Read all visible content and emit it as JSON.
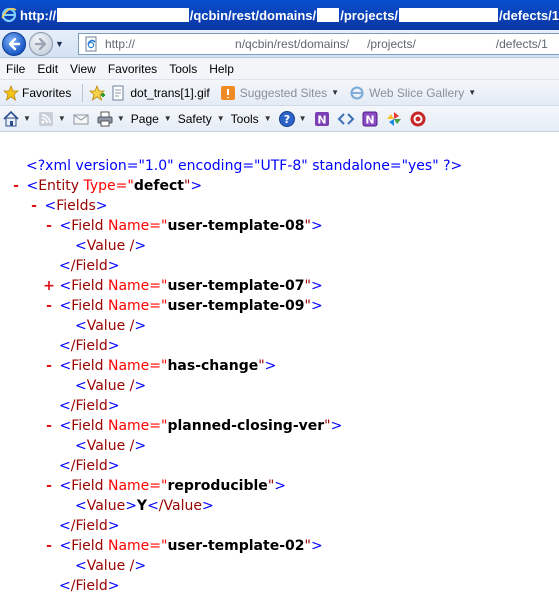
{
  "window": {
    "url_prefix": "http://",
    "url_part_1": "/qcbin/rest/domains/",
    "url_part_2": "/projects/",
    "url_part_3": "/defects/1"
  },
  "address_bar": {
    "url_prefix": "http://",
    "url_part_1": "n/qcbin/rest/domains/",
    "url_part_2": "/projects/",
    "url_part_3": "/defects/1"
  },
  "menu": [
    "File",
    "Edit",
    "View",
    "Favorites",
    "Tools",
    "Help"
  ],
  "favorites_bar": {
    "favorites_label": "Favorites",
    "items": [
      {
        "label": "dot_trans[1].gif",
        "icon": "page-icon",
        "enabled": true
      },
      {
        "label": "Suggested Sites",
        "icon": "suggested-sites-icon",
        "enabled": false
      },
      {
        "label": "Web Slice Gallery",
        "icon": "ie-icon",
        "enabled": false
      }
    ]
  },
  "command_bar": {
    "page_label": "Page",
    "safety_label": "Safety",
    "tools_label": "Tools"
  },
  "xml": {
    "declaration_open": "<?xml ",
    "version_attr": "version=\"1.0\"",
    "encoding_attr": " encoding=\"UTF-8\"",
    "standalone_attr": " standalone=\"yes\"",
    "declaration_close": " ?>",
    "entity_tag_open": "<Entity",
    "type_attr": " Type=\"",
    "type_value": "defect",
    "attr_close": "\">",
    "fields_open": "<Fields>",
    "field_tag_open": "<Field",
    "name_attr": " Name=\"",
    "value_empty": "<Value />",
    "value_open": "<Value>",
    "value_close": "</Value>",
    "field_close": "</Field>",
    "fields": [
      {
        "name": "user-template-08",
        "toggle": "-",
        "value": ""
      },
      {
        "name": "user-template-07",
        "toggle": "+",
        "value": null
      },
      {
        "name": "user-template-09",
        "toggle": "-",
        "value": ""
      },
      {
        "name": "has-change",
        "toggle": "-",
        "value": ""
      },
      {
        "name": "planned-closing-ver",
        "toggle": "-",
        "value": ""
      },
      {
        "name": "reproducible",
        "toggle": "-",
        "value": "Y"
      },
      {
        "name": "user-template-02",
        "toggle": "-",
        "value": ""
      }
    ]
  },
  "colors": {
    "xml_declaration": "#0000ff",
    "tag_name": "#990000",
    "attribute_value": "#000000",
    "collapse_toggle": "#dd1111"
  }
}
